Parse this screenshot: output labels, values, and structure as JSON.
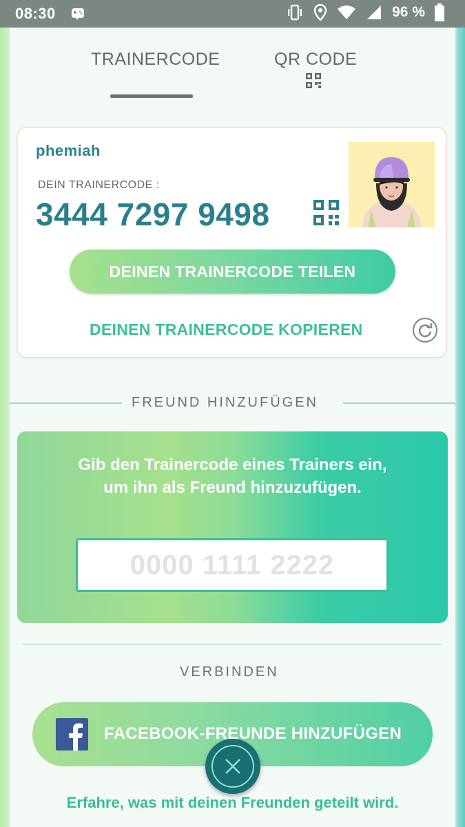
{
  "status_bar": {
    "time": "08:30",
    "battery_percent": "96 %",
    "icons": [
      "game-notification-icon",
      "vibrate-icon",
      "location-icon",
      "wifi-icon",
      "signal-icon",
      "battery-icon"
    ]
  },
  "tabs": [
    {
      "label": "TRAINERCODE",
      "active": true
    },
    {
      "label": "QR CODE",
      "active": false
    }
  ],
  "trainer_card": {
    "username": "phemiah",
    "code_label": "DEIN TRAINERCODE :",
    "code": "3444 7297 9498",
    "share_label": "DEINEN TRAINERCODE TEILEN",
    "copy_label": "DEINEN TRAINERCODE KOPIEREN"
  },
  "add_friend": {
    "section_title": "FREUND HINZUFÜGEN",
    "instructions": "Gib den Trainercode eines Trainers ein, um ihn als Freund hinzuzufügen.",
    "input_value": "",
    "input_placeholder": "0000 1111 2222"
  },
  "connect": {
    "section_title": "VERBINDEN",
    "facebook_label": "FACEBOOK-FREUNDE HINZUFÜGEN",
    "info_link": "Erfahre, was mit deinen Freunden geteilt wird."
  },
  "colors": {
    "accent_teal": "#2a7f8d",
    "accent_green": "#3cc19a",
    "status_bar": "#7d8781",
    "facebook_blue": "#3b5998"
  }
}
